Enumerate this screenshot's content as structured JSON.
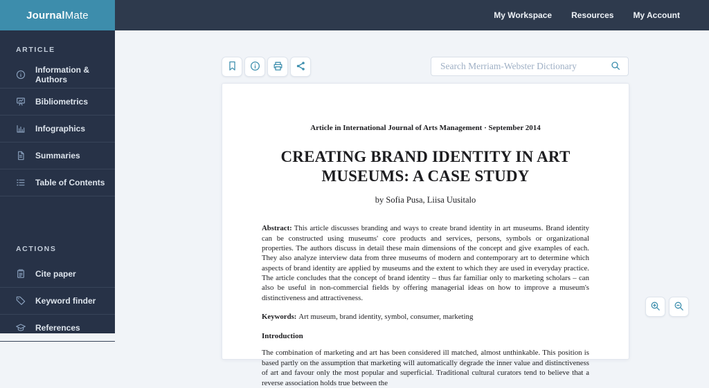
{
  "brand": {
    "name_bold": "Journal",
    "name_light": "Mate"
  },
  "header": {
    "nav": [
      {
        "label": "My Workspace"
      },
      {
        "label": "Resources"
      },
      {
        "label": "My Account"
      }
    ]
  },
  "sidebar": {
    "sections": [
      {
        "title": "ARTICLE",
        "items": [
          {
            "label": "Information & Authors",
            "icon": "info-circle-icon"
          },
          {
            "label": "Bibliometrics",
            "icon": "presentation-chart-icon"
          },
          {
            "label": "Infographics",
            "icon": "bar-chart-icon"
          },
          {
            "label": "Summaries",
            "icon": "document-icon"
          },
          {
            "label": "Table of Contents",
            "icon": "list-icon"
          }
        ]
      },
      {
        "title": "ACTIONS",
        "items": [
          {
            "label": "Cite paper",
            "icon": "notepad-icon"
          },
          {
            "label": "Keyword finder",
            "icon": "tag-icon"
          },
          {
            "label": "References",
            "icon": "graduation-cap-icon"
          }
        ]
      }
    ]
  },
  "toolbar": {
    "buttons": [
      {
        "name": "bookmark"
      },
      {
        "name": "info"
      },
      {
        "name": "print"
      },
      {
        "name": "share"
      }
    ]
  },
  "search": {
    "placeholder": "Search Merriam-Webster Dictionary",
    "icon": "search-icon"
  },
  "document": {
    "journal_line": "Article in International Journal of Arts Management · September 2014",
    "title": "CREATING BRAND IDENTITY IN ART MUSEUMS: A CASE STUDY",
    "byline": "by Sofia Pusa, Liisa Uusitalo",
    "abstract_label": "Abstract:",
    "abstract_text": "This article discusses branding and ways to create brand identity in art museums. Brand identity can be constructed using museums' core products and services, persons, symbols or organizational properties. The authors discuss in detail these main dimensions of the concept and give examples of each. They also analyze interview data from three museums of modern and contemporary art to determine which aspects of brand identity are applied by museums and the extent to which they are used in everyday practice. The article concludes that the concept of brand identity – thus far familiar only to marketing scholars – can also be useful in non-commercial fields by offering managerial ideas on how to improve a museum's distinctiveness and attractiveness.",
    "keywords_label": "Keywords:",
    "keywords_text": "Art museum, brand identity, symbol, consumer, marketing",
    "section_heading": "Introduction",
    "intro_text": "The combination of marketing and art has been considered ill matched, almost unthinkable. This position is based partly on the assumption that marketing will automatically degrade the inner value and distinctiveness of art and favour only the most popular and superficial. Traditional cultural curators tend to believe that a reverse association holds true between the"
  },
  "colors": {
    "brand_teal": "#3d8dac",
    "header_navy": "#2e3a4d",
    "sidebar_navy": "#273247",
    "page_background": "#f1f4f8"
  }
}
